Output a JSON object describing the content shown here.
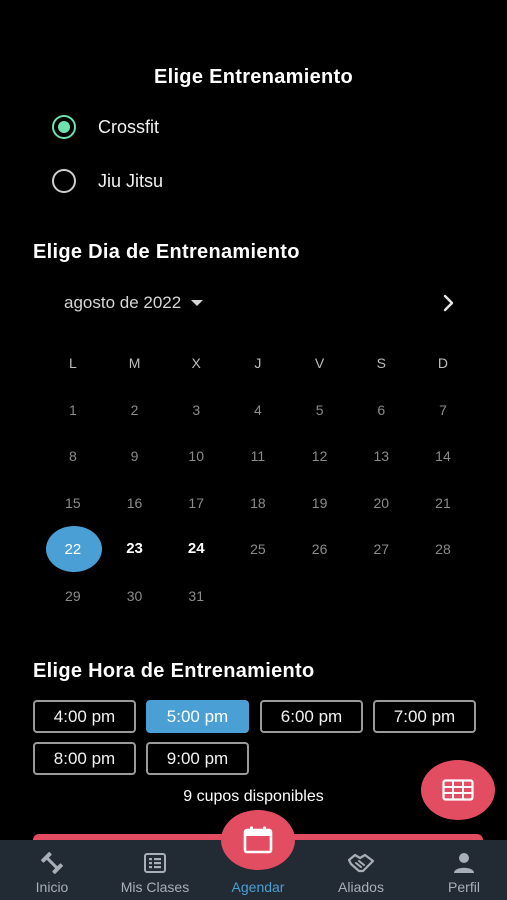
{
  "training": {
    "title": "Elige Entrenamiento",
    "options": [
      {
        "label": "Crossfit",
        "checked": true
      },
      {
        "label": "Jiu Jitsu",
        "checked": false
      }
    ]
  },
  "day": {
    "title": "Elige Dia de Entrenamiento",
    "month_label": "agosto de 2022",
    "weekdays": [
      "L",
      "M",
      "X",
      "J",
      "V",
      "S",
      "D"
    ],
    "weeks": [
      [
        "1",
        "2",
        "3",
        "4",
        "5",
        "6",
        "7"
      ],
      [
        "8",
        "9",
        "10",
        "11",
        "12",
        "13",
        "14"
      ],
      [
        "15",
        "16",
        "17",
        "18",
        "19",
        "20",
        "21"
      ],
      [
        "22",
        "23",
        "24",
        "25",
        "26",
        "27",
        "28"
      ],
      [
        "29",
        "30",
        "31"
      ]
    ],
    "selected_day": "22",
    "available_days": [
      "23",
      "24"
    ]
  },
  "hour": {
    "title": "Elige Hora de Entrenamiento",
    "slots": [
      "4:00 pm",
      "5:00 pm",
      "6:00 pm",
      "7:00 pm",
      "8:00 pm",
      "9:00 pm"
    ],
    "selected": "5:00 pm",
    "availability": "9 cupos disponibles"
  },
  "colors": {
    "accent_blue": "#4aa0d5",
    "accent_red": "#e24d62",
    "radio_green": "#6fe0b0",
    "tabbar_bg": "#222a33"
  },
  "fab": {
    "icon": "table-grid-icon"
  },
  "tabbar": {
    "items": [
      {
        "label": "Inicio",
        "icon": "dumbbell-icon"
      },
      {
        "label": "Mis Clases",
        "icon": "list-icon"
      },
      {
        "label": "Agendar",
        "icon": "calendar-icon",
        "current": true
      },
      {
        "label": "Aliados",
        "icon": "handshake-icon"
      },
      {
        "label": "Perfil",
        "icon": "person-icon"
      }
    ]
  }
}
